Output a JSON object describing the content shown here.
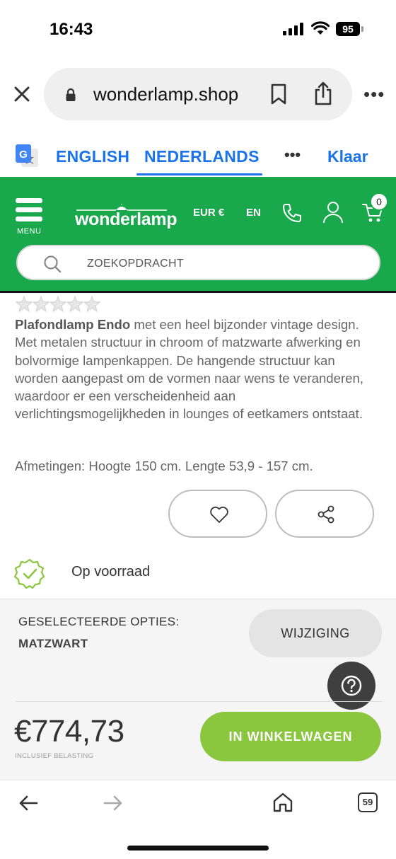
{
  "status_bar": {
    "time": "16:43",
    "battery": "95"
  },
  "browser": {
    "url": "wonderlamp.shop",
    "icons": [
      "close-icon",
      "lock-icon",
      "bookmark-icon",
      "share-icon",
      "more-icon"
    ]
  },
  "translate": {
    "languages": [
      "ENGLISH",
      "NEDERLANDS"
    ],
    "selected": "NEDERLANDS",
    "more": "•••",
    "done": "Klaar"
  },
  "site_header": {
    "menu_label": "MENU",
    "logo": "wonderlamp",
    "currency": "EUR €",
    "language": "EN",
    "cart_count": "0",
    "search_placeholder": "ZOEKOPDRACHT",
    "brand_color": "#19a94c"
  },
  "product": {
    "rating": 0,
    "name": "Plafondlamp Endo",
    "description": " met een heel bijzonder vintage design. Met metalen structuur in chroom of matzwarte afwerking en bolvormige lampenkappen. De hangende structuur kan worden aangepast om de vormen naar wens te veranderen, waardoor er een verscheidenheid aan verlichtingsmogelijkheden in lounges of eetkamers ontstaat.",
    "dimensions": "Afmetingen: Hoogte 150 cm. Lengte 53,9 - 157 cm.",
    "stock": "Op voorraad"
  },
  "options": {
    "label": "GESELECTEERDE OPTIES:",
    "value": "MATZWART",
    "change_label": "WIJZIGING",
    "price": "€774,73",
    "price_note": "INCLUSIEF BELASTING",
    "add_to_cart": "IN WINKELWAGEN",
    "cart_button_color": "#8bc63f"
  },
  "bottom_bar": {
    "tabs_count": "59"
  }
}
